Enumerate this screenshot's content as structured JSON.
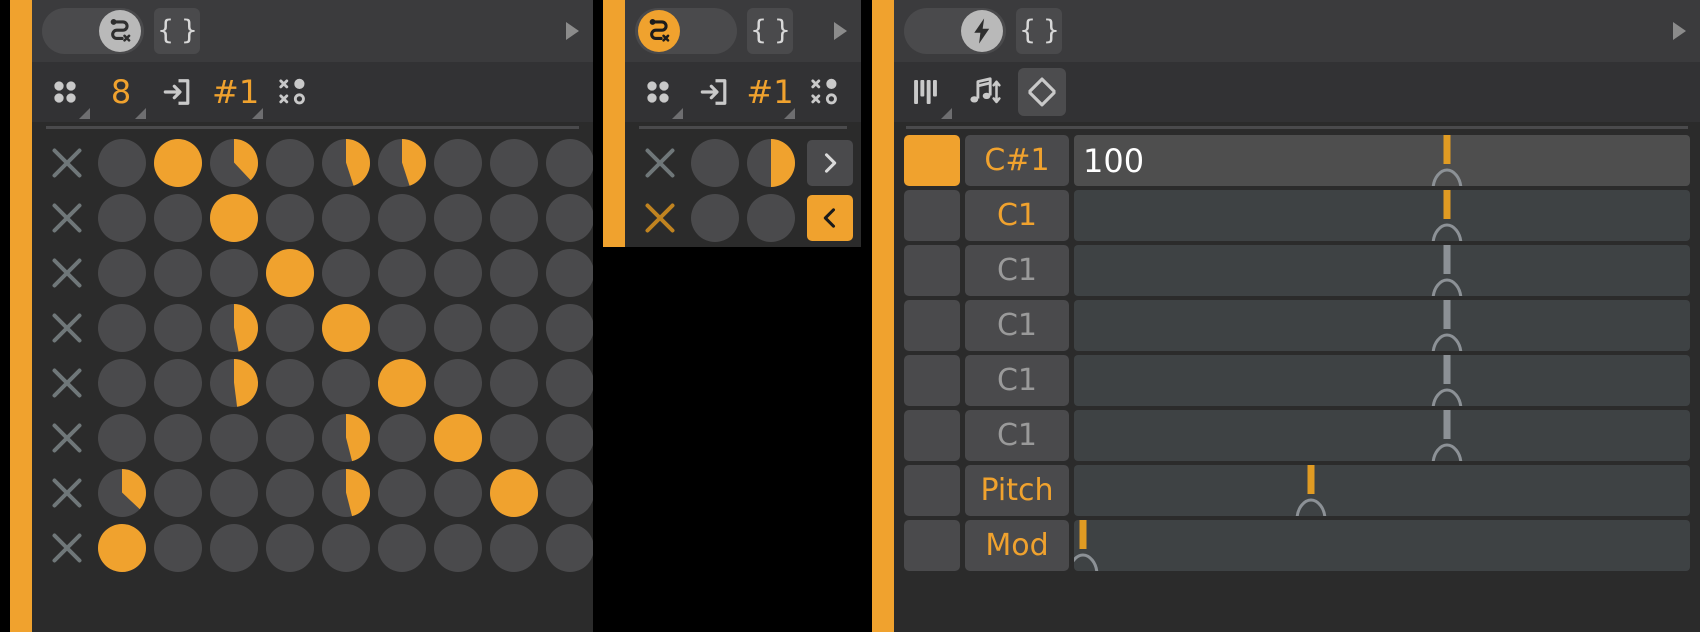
{
  "app": {
    "accent_color": "#f0a22e",
    "background": "#000000",
    "panel_bg": "#2b2b2b"
  },
  "panels": {
    "left": {
      "name": "sequencer-grid-panel",
      "titlebar": {
        "toggle_icon": "snake-path-icon",
        "toggle_state": "off",
        "braces_label": "{ }",
        "play_icon": "play-triangle-icon"
      },
      "toolbar": {
        "items": [
          {
            "icon": "four-dots-icon",
            "label": "",
            "kind": "icon"
          },
          {
            "icon": "",
            "label": "8",
            "kind": "number"
          },
          {
            "icon": "enter-box-icon",
            "label": "",
            "kind": "icon"
          },
          {
            "icon": "",
            "label": "#1",
            "kind": "number"
          },
          {
            "icon": "randomize-dots-icon",
            "label": "",
            "kind": "icon"
          }
        ]
      },
      "grid": {
        "columns": 9,
        "rows": [
          {
            "clear_icon": "x-icon",
            "clear_hot": false,
            "pads": [
              0,
              100,
              38,
              0,
              45,
              45,
              0,
              0,
              0
            ],
            "arrow": "<",
            "arrow_active": true
          },
          {
            "clear_icon": "x-icon",
            "clear_hot": false,
            "pads": [
              0,
              0,
              100,
              0,
              0,
              0,
              0,
              0,
              0
            ],
            "arrow": ">",
            "arrow_active": false
          },
          {
            "clear_icon": "x-icon",
            "clear_hot": false,
            "pads": [
              0,
              0,
              0,
              100,
              0,
              0,
              0,
              0,
              0
            ],
            "arrow": ">",
            "arrow_active": false
          },
          {
            "clear_icon": "x-icon",
            "clear_hot": false,
            "pads": [
              0,
              0,
              47,
              0,
              100,
              0,
              0,
              0,
              0
            ],
            "arrow": ">",
            "arrow_active": false
          },
          {
            "clear_icon": "x-icon",
            "clear_hot": false,
            "pads": [
              0,
              0,
              48,
              0,
              0,
              100,
              0,
              0,
              0
            ],
            "arrow": ">",
            "arrow_active": false
          },
          {
            "clear_icon": "x-icon",
            "clear_hot": false,
            "pads": [
              0,
              0,
              0,
              0,
              46,
              0,
              100,
              0,
              0
            ],
            "arrow": ">",
            "arrow_active": false
          },
          {
            "clear_icon": "x-icon",
            "clear_hot": false,
            "pads": [
              37,
              0,
              0,
              0,
              46,
              0,
              0,
              100,
              0
            ],
            "arrow": ">",
            "arrow_active": false
          },
          {
            "clear_icon": "x-icon",
            "clear_hot": false,
            "pads": [
              100,
              0,
              0,
              0,
              0,
              0,
              0,
              0,
              0
            ],
            "arrow": ">",
            "arrow_active": false
          }
        ]
      }
    },
    "middle": {
      "name": "sequencer-grid-panel-2",
      "titlebar": {
        "toggle_icon": "snake-path-icon",
        "toggle_state": "on",
        "braces_label": "{ }",
        "play_icon": "play-triangle-icon"
      },
      "toolbar": {
        "items": [
          {
            "icon": "four-dots-icon",
            "label": "",
            "kind": "icon"
          },
          {
            "icon": "enter-box-icon",
            "label": "",
            "kind": "icon"
          },
          {
            "icon": "",
            "label": "#1",
            "kind": "number"
          },
          {
            "icon": "randomize-dots-icon",
            "label": "",
            "kind": "icon"
          }
        ]
      },
      "grid": {
        "columns": 2,
        "rows": [
          {
            "clear_icon": "x-icon",
            "clear_hot": false,
            "pads": [
              0,
              50
            ],
            "arrow": ">",
            "arrow_active": false
          },
          {
            "clear_icon": "x-icon",
            "clear_hot": true,
            "pads": [
              0,
              0
            ],
            "arrow": "<",
            "arrow_active": true
          }
        ]
      }
    },
    "right": {
      "name": "note-list-panel",
      "titlebar": {
        "toggle_icon": "lightning-bolt-icon",
        "toggle_state": "off",
        "braces_label": "{ }",
        "play_icon": "play-triangle-icon"
      },
      "toolbar": {
        "items": [
          {
            "icon": "piano-keys-icon",
            "label": "",
            "kind": "icon",
            "boxed": false,
            "corner": true
          },
          {
            "icon": "note-updown-icon",
            "label": "",
            "kind": "icon",
            "boxed": false,
            "corner": false
          },
          {
            "icon": "diamond-chevrons-icon",
            "label": "",
            "kind": "icon",
            "boxed": true,
            "corner": false
          }
        ]
      },
      "rows": [
        {
          "swatch_on": true,
          "note": "C#1",
          "note_style": "hot",
          "value": "100",
          "slider_bright": true,
          "marker_pct": 60.5,
          "marker_hot": true
        },
        {
          "swatch_on": false,
          "note": "C1",
          "note_style": "hot",
          "value": "",
          "slider_bright": false,
          "marker_pct": 60.5,
          "marker_hot": true
        },
        {
          "swatch_on": false,
          "note": "C1",
          "note_style": "dim",
          "value": "",
          "slider_bright": false,
          "marker_pct": 60.5,
          "marker_hot": false
        },
        {
          "swatch_on": false,
          "note": "C1",
          "note_style": "dim",
          "value": "",
          "slider_bright": false,
          "marker_pct": 60.5,
          "marker_hot": false
        },
        {
          "swatch_on": false,
          "note": "C1",
          "note_style": "dim",
          "value": "",
          "slider_bright": false,
          "marker_pct": 60.5,
          "marker_hot": false
        },
        {
          "swatch_on": false,
          "note": "C1",
          "note_style": "dim",
          "value": "",
          "slider_bright": false,
          "marker_pct": 60.5,
          "marker_hot": false
        },
        {
          "swatch_on": false,
          "note": "Pitch",
          "note_style": "hot",
          "value": "",
          "slider_bright": false,
          "marker_pct": 38.5,
          "marker_hot": true
        },
        {
          "swatch_on": false,
          "note": "Mod",
          "note_style": "hot",
          "value": "",
          "slider_bright": false,
          "marker_pct": 1.4,
          "marker_hot": true
        }
      ]
    }
  }
}
